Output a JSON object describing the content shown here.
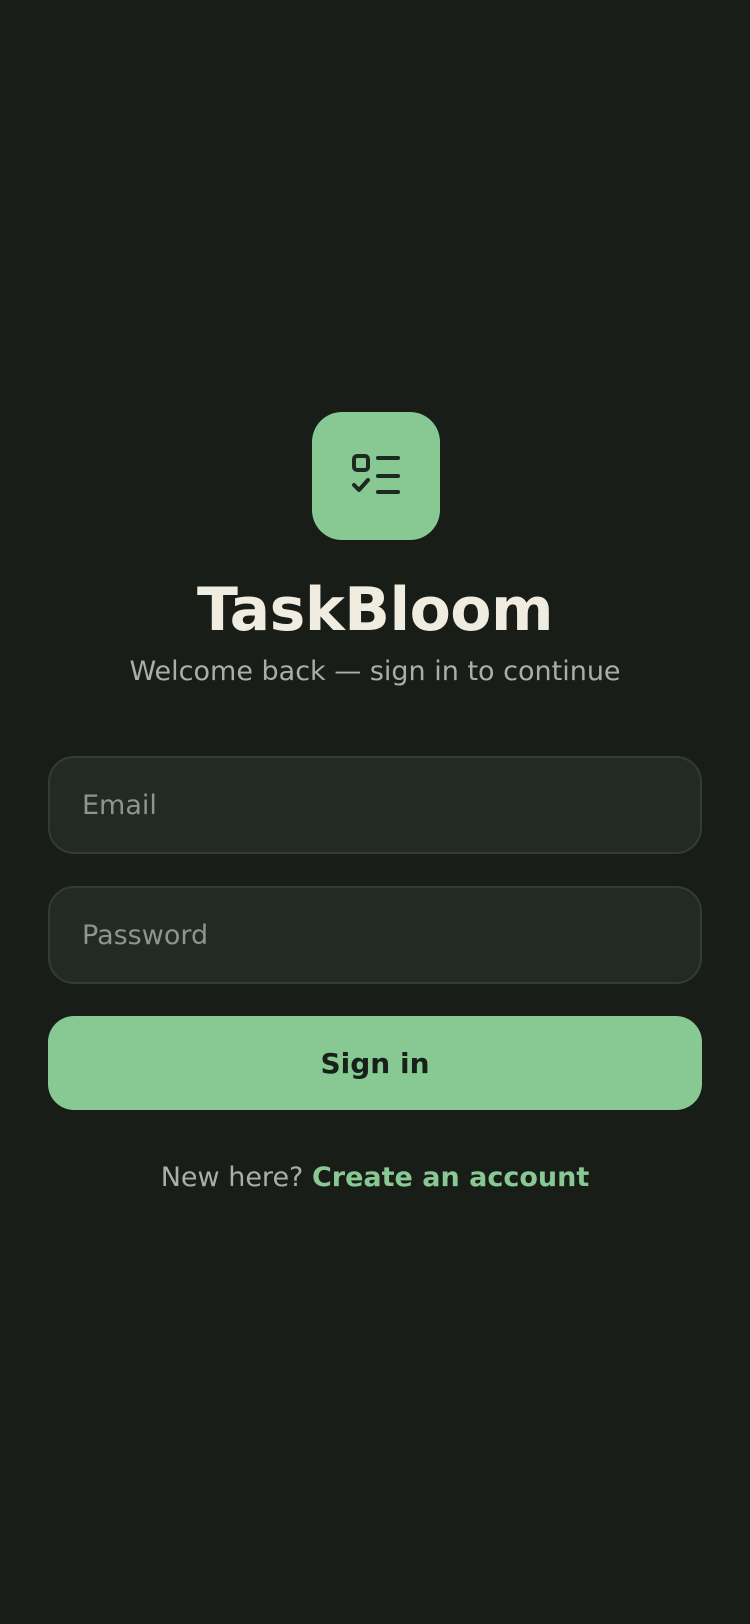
{
  "app": {
    "title": "TaskBloom",
    "subtitle": "Welcome back — sign in to continue",
    "logo_icon": "checklist-icon"
  },
  "form": {
    "email": {
      "value": "",
      "placeholder": "Email"
    },
    "password": {
      "value": "",
      "placeholder": "Password"
    },
    "submit_label": "Sign in"
  },
  "footer": {
    "prompt": "New here?",
    "link_label": "Create an account"
  },
  "colors": {
    "background": "#181d18",
    "accent": "#88c893",
    "field_background": "#232a24",
    "title_text": "#f1ece0",
    "muted_text": "#a9afa7"
  }
}
